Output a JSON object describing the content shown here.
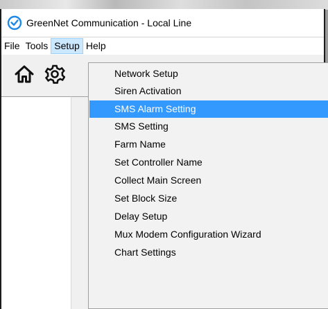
{
  "window": {
    "title": "GreenNet Communication - Local Line",
    "app_icon": "check-circle-icon",
    "accent_color": "#1e88e5"
  },
  "menubar": {
    "items": [
      "File",
      "Tools",
      "Setup",
      "Help"
    ],
    "open_menu": "Setup"
  },
  "toolbar": {
    "icons": [
      "home-icon",
      "gear-icon"
    ]
  },
  "setup_menu": {
    "items": [
      "Network Setup",
      "Siren Activation",
      "SMS Alarm Setting",
      "SMS Setting",
      "Farm Name",
      "Set Controller Name",
      "Collect Main Screen",
      "Set Block Size",
      "Delay Setup",
      "Mux Modem Configuration Wizard",
      "Chart Settings"
    ],
    "highlighted": "SMS Alarm Setting",
    "highlight_color": "#3399ff"
  }
}
